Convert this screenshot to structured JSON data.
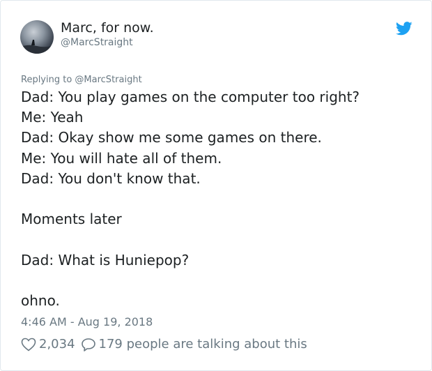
{
  "tweet": {
    "author_name": "Marc, for now.",
    "author_handle": "@MarcStraight",
    "replying_to": "Replying to @MarcStraight",
    "lines": [
      "Dad: You play games on the computer too right?",
      "Me: Yeah",
      "Dad: Okay show me some games on there.",
      "Me: You will hate all of them.",
      "Dad: You don't know that.",
      "",
      "Moments later",
      "",
      "Dad: What is Huniepop?",
      "",
      "ohno."
    ],
    "timestamp": "4:46 AM - Aug 19, 2018",
    "likes": "2,034",
    "replies_text": "179 people are talking about this"
  },
  "icons": {
    "brand": "twitter-bird-icon",
    "like": "heart-icon",
    "reply": "reply-bubble-icon"
  },
  "colors": {
    "twitter_blue": "#1da1f2",
    "muted_text": "#697882",
    "body_text": "#1c2022"
  }
}
